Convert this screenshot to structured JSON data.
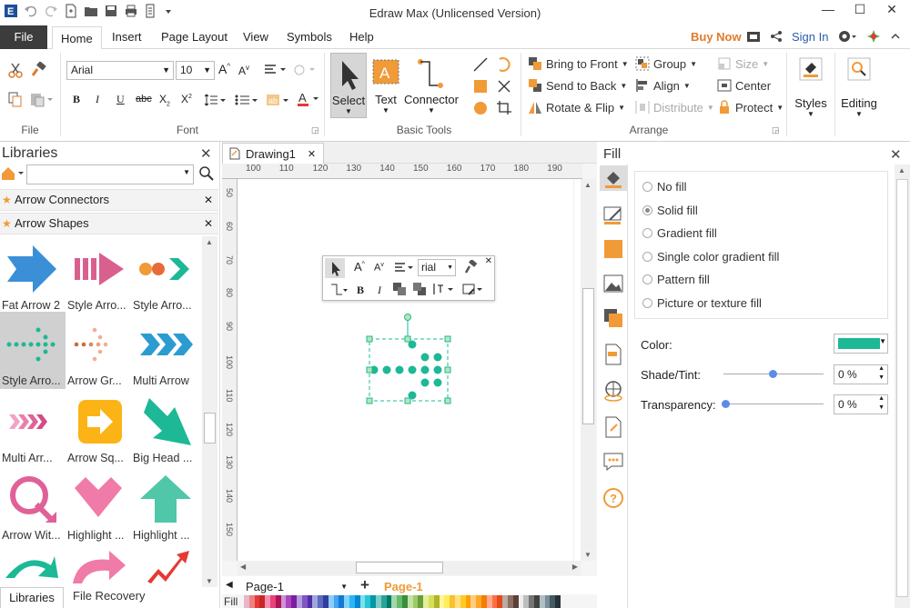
{
  "window": {
    "title": "Edraw Max (Unlicensed Version)",
    "minimize": "—",
    "maximize": "☐",
    "close": "✕"
  },
  "menu": {
    "file": "File",
    "tabs": [
      "Home",
      "Insert",
      "Page Layout",
      "View",
      "Symbols",
      "Help"
    ],
    "buy_now": "Buy Now",
    "sign_in": "Sign In"
  },
  "ribbon": {
    "file_group": "File",
    "font_group": "Font",
    "font_name": "Arial",
    "font_size": "10",
    "basic_tools_group": "Basic Tools",
    "select": "Select",
    "text": "Text",
    "connector": "Connector",
    "arrange_group": "Arrange",
    "bring_to_front": "Bring to Front",
    "send_to_back": "Send to Back",
    "rotate_flip": "Rotate & Flip",
    "group": "Group",
    "align": "Align",
    "distribute": "Distribute",
    "size": "Size",
    "center": "Center",
    "protect": "Protect",
    "styles": "Styles",
    "editing": "Editing",
    "accent": "#f19a38"
  },
  "libraries": {
    "title": "Libraries",
    "categories": [
      "Arrow Connectors",
      "Arrow Shapes"
    ],
    "shapes": [
      "Fat Arrow 2",
      "Style Arro...",
      "Style Arro...",
      "Style Arro...",
      "Arrow Gr...",
      "Multi Arrow",
      "Multi Arr...",
      "Arrow Sq...",
      "Big Head ...",
      "Arrow Wit...",
      "Highlight ...",
      "Highlight ..."
    ],
    "bottom_tabs": [
      "Libraries",
      "File Recovery"
    ]
  },
  "document": {
    "tab": "Drawing1",
    "ruler_h": [
      "100",
      "110",
      "120",
      "130",
      "140",
      "150",
      "160",
      "170",
      "180",
      "190"
    ],
    "ruler_v": [
      "50",
      "60",
      "70",
      "80",
      "90",
      "100",
      "110",
      "120",
      "130",
      "140",
      "150"
    ],
    "float_font": "rial",
    "page_select": "Page-1",
    "page_tab": "Page-1",
    "fill_label": "Fill"
  },
  "fill_panel": {
    "title": "Fill",
    "options": [
      "No fill",
      "Solid fill",
      "Gradient fill",
      "Single color gradient fill",
      "Pattern fill",
      "Picture or texture fill"
    ],
    "selected": "Solid fill",
    "color_label": "Color:",
    "color_value": "#1db896",
    "shade_label": "Shade/Tint:",
    "shade_value": "0 %",
    "transparency_label": "Transparency:",
    "transparency_value": "0 %"
  }
}
